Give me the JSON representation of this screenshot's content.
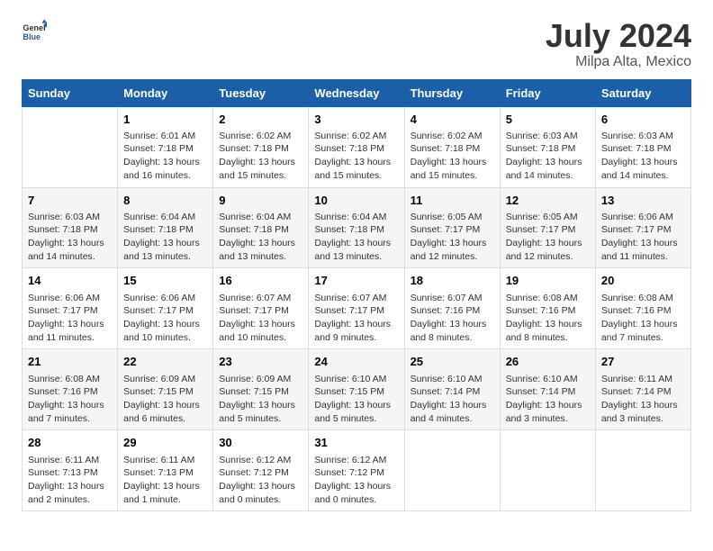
{
  "header": {
    "logo_general": "General",
    "logo_blue": "Blue",
    "title": "July 2024",
    "subtitle": "Milpa Alta, Mexico"
  },
  "weekdays": [
    "Sunday",
    "Monday",
    "Tuesday",
    "Wednesday",
    "Thursday",
    "Friday",
    "Saturday"
  ],
  "weeks": [
    [
      {
        "day": null,
        "info": null
      },
      {
        "day": "1",
        "info": "Sunrise: 6:01 AM\nSunset: 7:18 PM\nDaylight: 13 hours\nand 16 minutes."
      },
      {
        "day": "2",
        "info": "Sunrise: 6:02 AM\nSunset: 7:18 PM\nDaylight: 13 hours\nand 15 minutes."
      },
      {
        "day": "3",
        "info": "Sunrise: 6:02 AM\nSunset: 7:18 PM\nDaylight: 13 hours\nand 15 minutes."
      },
      {
        "day": "4",
        "info": "Sunrise: 6:02 AM\nSunset: 7:18 PM\nDaylight: 13 hours\nand 15 minutes."
      },
      {
        "day": "5",
        "info": "Sunrise: 6:03 AM\nSunset: 7:18 PM\nDaylight: 13 hours\nand 14 minutes."
      },
      {
        "day": "6",
        "info": "Sunrise: 6:03 AM\nSunset: 7:18 PM\nDaylight: 13 hours\nand 14 minutes."
      }
    ],
    [
      {
        "day": "7",
        "info": "Sunrise: 6:03 AM\nSunset: 7:18 PM\nDaylight: 13 hours\nand 14 minutes."
      },
      {
        "day": "8",
        "info": "Sunrise: 6:04 AM\nSunset: 7:18 PM\nDaylight: 13 hours\nand 13 minutes."
      },
      {
        "day": "9",
        "info": "Sunrise: 6:04 AM\nSunset: 7:18 PM\nDaylight: 13 hours\nand 13 minutes."
      },
      {
        "day": "10",
        "info": "Sunrise: 6:04 AM\nSunset: 7:18 PM\nDaylight: 13 hours\nand 13 minutes."
      },
      {
        "day": "11",
        "info": "Sunrise: 6:05 AM\nSunset: 7:17 PM\nDaylight: 13 hours\nand 12 minutes."
      },
      {
        "day": "12",
        "info": "Sunrise: 6:05 AM\nSunset: 7:17 PM\nDaylight: 13 hours\nand 12 minutes."
      },
      {
        "day": "13",
        "info": "Sunrise: 6:06 AM\nSunset: 7:17 PM\nDaylight: 13 hours\nand 11 minutes."
      }
    ],
    [
      {
        "day": "14",
        "info": "Sunrise: 6:06 AM\nSunset: 7:17 PM\nDaylight: 13 hours\nand 11 minutes."
      },
      {
        "day": "15",
        "info": "Sunrise: 6:06 AM\nSunset: 7:17 PM\nDaylight: 13 hours\nand 10 minutes."
      },
      {
        "day": "16",
        "info": "Sunrise: 6:07 AM\nSunset: 7:17 PM\nDaylight: 13 hours\nand 10 minutes."
      },
      {
        "day": "17",
        "info": "Sunrise: 6:07 AM\nSunset: 7:17 PM\nDaylight: 13 hours\nand 9 minutes."
      },
      {
        "day": "18",
        "info": "Sunrise: 6:07 AM\nSunset: 7:16 PM\nDaylight: 13 hours\nand 8 minutes."
      },
      {
        "day": "19",
        "info": "Sunrise: 6:08 AM\nSunset: 7:16 PM\nDaylight: 13 hours\nand 8 minutes."
      },
      {
        "day": "20",
        "info": "Sunrise: 6:08 AM\nSunset: 7:16 PM\nDaylight: 13 hours\nand 7 minutes."
      }
    ],
    [
      {
        "day": "21",
        "info": "Sunrise: 6:08 AM\nSunset: 7:16 PM\nDaylight: 13 hours\nand 7 minutes."
      },
      {
        "day": "22",
        "info": "Sunrise: 6:09 AM\nSunset: 7:15 PM\nDaylight: 13 hours\nand 6 minutes."
      },
      {
        "day": "23",
        "info": "Sunrise: 6:09 AM\nSunset: 7:15 PM\nDaylight: 13 hours\nand 5 minutes."
      },
      {
        "day": "24",
        "info": "Sunrise: 6:10 AM\nSunset: 7:15 PM\nDaylight: 13 hours\nand 5 minutes."
      },
      {
        "day": "25",
        "info": "Sunrise: 6:10 AM\nSunset: 7:14 PM\nDaylight: 13 hours\nand 4 minutes."
      },
      {
        "day": "26",
        "info": "Sunrise: 6:10 AM\nSunset: 7:14 PM\nDaylight: 13 hours\nand 3 minutes."
      },
      {
        "day": "27",
        "info": "Sunrise: 6:11 AM\nSunset: 7:14 PM\nDaylight: 13 hours\nand 3 minutes."
      }
    ],
    [
      {
        "day": "28",
        "info": "Sunrise: 6:11 AM\nSunset: 7:13 PM\nDaylight: 13 hours\nand 2 minutes."
      },
      {
        "day": "29",
        "info": "Sunrise: 6:11 AM\nSunset: 7:13 PM\nDaylight: 13 hours\nand 1 minute."
      },
      {
        "day": "30",
        "info": "Sunrise: 6:12 AM\nSunset: 7:12 PM\nDaylight: 13 hours\nand 0 minutes."
      },
      {
        "day": "31",
        "info": "Sunrise: 6:12 AM\nSunset: 7:12 PM\nDaylight: 13 hours\nand 0 minutes."
      },
      {
        "day": null,
        "info": null
      },
      {
        "day": null,
        "info": null
      },
      {
        "day": null,
        "info": null
      }
    ]
  ]
}
